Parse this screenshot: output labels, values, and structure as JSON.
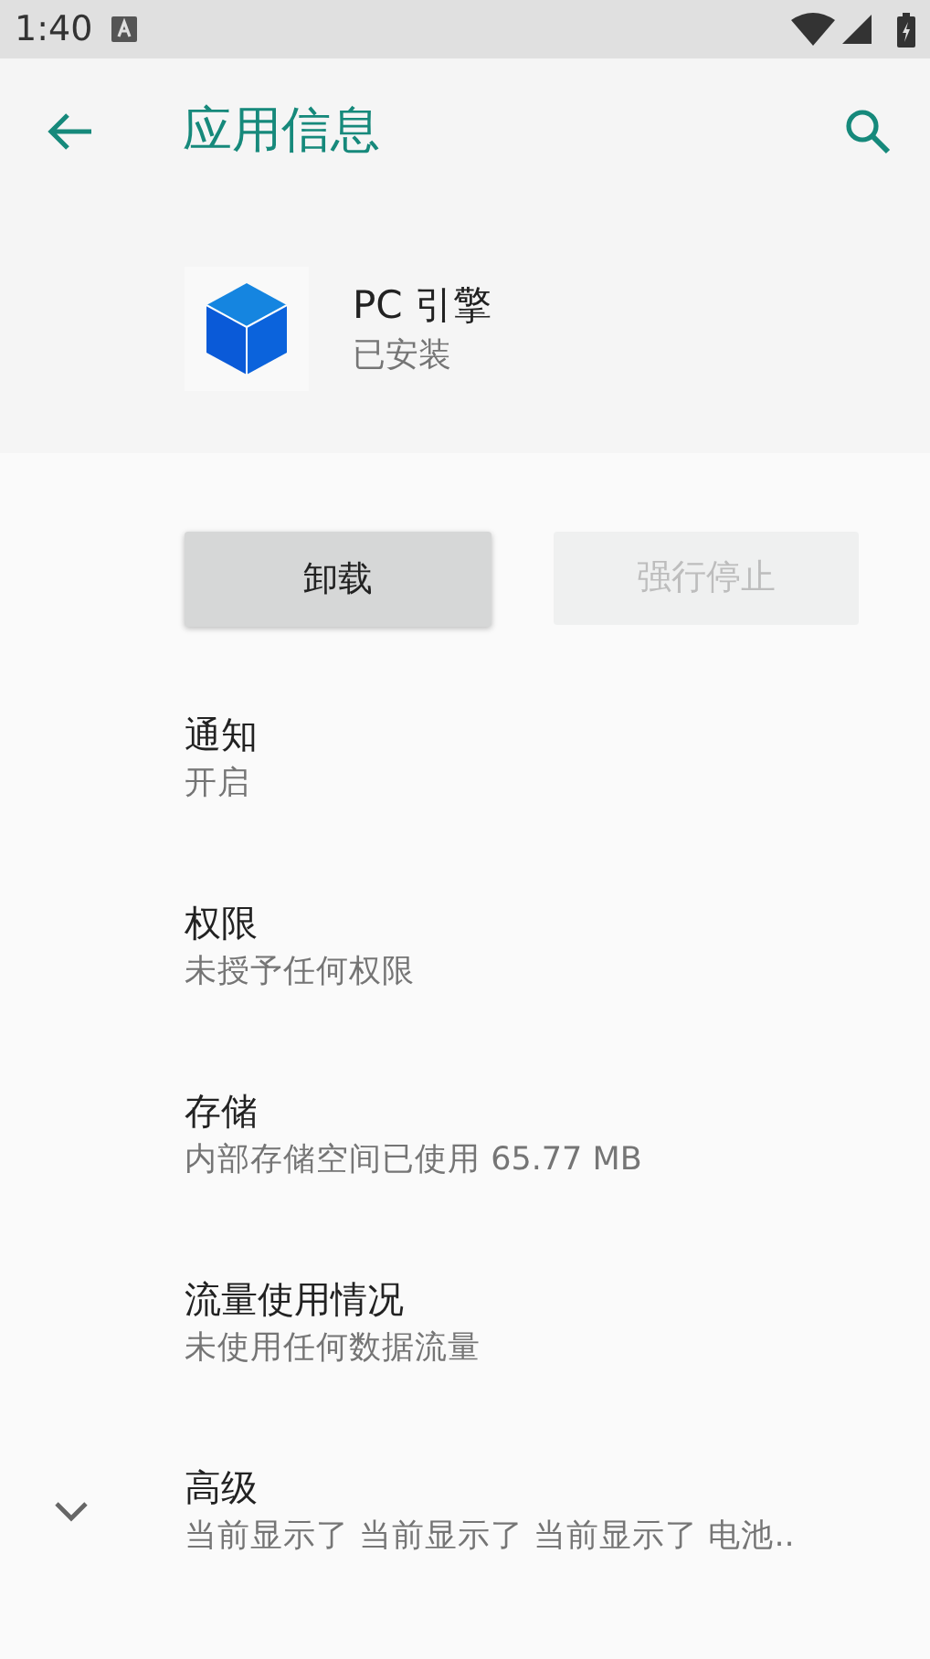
{
  "status_bar": {
    "time": "1:40"
  },
  "toolbar": {
    "title": "应用信息"
  },
  "app": {
    "name": "PC 引擎",
    "status": "已安装"
  },
  "buttons": [
    {
      "label": "卸载",
      "disabled": false
    },
    {
      "label": "强行停止",
      "disabled": true
    }
  ],
  "settings": [
    {
      "title": "通知",
      "summary": "开启"
    },
    {
      "title": "权限",
      "summary": "未授予任何权限"
    },
    {
      "title": "存储",
      "summary": "内部存储空间已使用 65.77 MB"
    },
    {
      "title": "流量使用情况",
      "summary": "未使用任何数据流量"
    },
    {
      "title": "高级",
      "summary": "当前显示了 当前显示了 当前显示了 电池..",
      "expanded": false
    }
  ]
}
